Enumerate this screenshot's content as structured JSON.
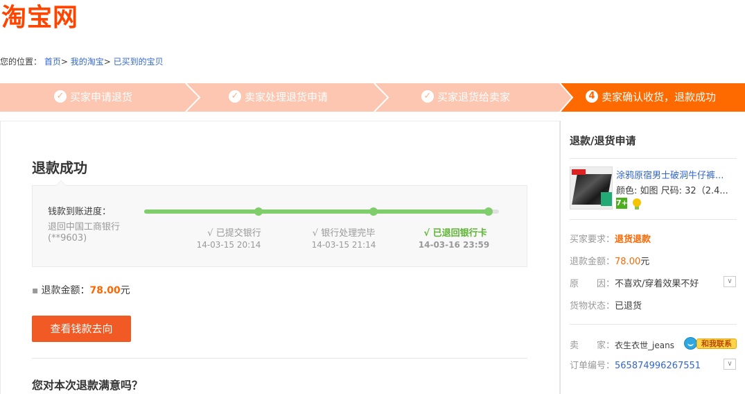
{
  "logo": {
    "text": "淘宝网",
    "color": "#ff4400"
  },
  "breadcrumb": {
    "label": "您的位置：",
    "items": [
      "首页",
      "我的淘宝",
      "已买到的宝贝"
    ],
    "separator": ">"
  },
  "steps": [
    {
      "label": "买家申请退货",
      "icon": "check-icon",
      "state": "done"
    },
    {
      "label": "卖家处理退货申请",
      "icon": "check-icon",
      "state": "done"
    },
    {
      "label": "买家退货给卖家",
      "icon": "check-icon",
      "state": "done"
    },
    {
      "label": "卖家确认收货，退款成功",
      "number": "4",
      "state": "active"
    }
  ],
  "main": {
    "title": "退款成功",
    "progress": {
      "label": "钱款到账进度：",
      "bank": "退回中国工商银行",
      "account": "(**9603)",
      "fraction": 0.98,
      "nodes": [
        {
          "label": "√ 已提交银行",
          "time": "14-03-15 20:14",
          "done": false
        },
        {
          "label": "√ 银行处理完毕",
          "time": "14-03-15 21:14",
          "done": false
        },
        {
          "label": "√ 已退回银行卡",
          "time": "14-03-16 23:59",
          "done": true
        }
      ]
    },
    "refund_label": "退款金额：",
    "refund_amount": "78.00",
    "refund_unit": "元",
    "button_label": "查看钱款去向",
    "question": "您对本次退款满意吗？"
  },
  "side": {
    "title": "退款/退货申请",
    "item": {
      "name": "涂鸦原宿男士破洞牛仔裤...",
      "sku": "颜色: 如图 尺码: 32（2.4...",
      "badge": "7+"
    },
    "rows": {
      "req_label": "买家要求：",
      "req_value": "退货退款",
      "amt_label": "退款金额：",
      "amt_value": "78.00",
      "amt_unit": "元",
      "reason_label": "原　　因：",
      "reason_value": "不喜欢/穿着效果不好",
      "status_label": "货物状态：",
      "status_value": "已退货",
      "seller_label": "卖　　家：",
      "seller_value": "衣生衣世_jeans",
      "contact_label": "和我联系",
      "order_label": "订单编号：",
      "order_value": "565874996267551"
    }
  },
  "colors": {
    "accent": "#ff6a00",
    "step_bg": "#fdc6b1",
    "success": "#5cb531",
    "link": "#3366cc"
  }
}
